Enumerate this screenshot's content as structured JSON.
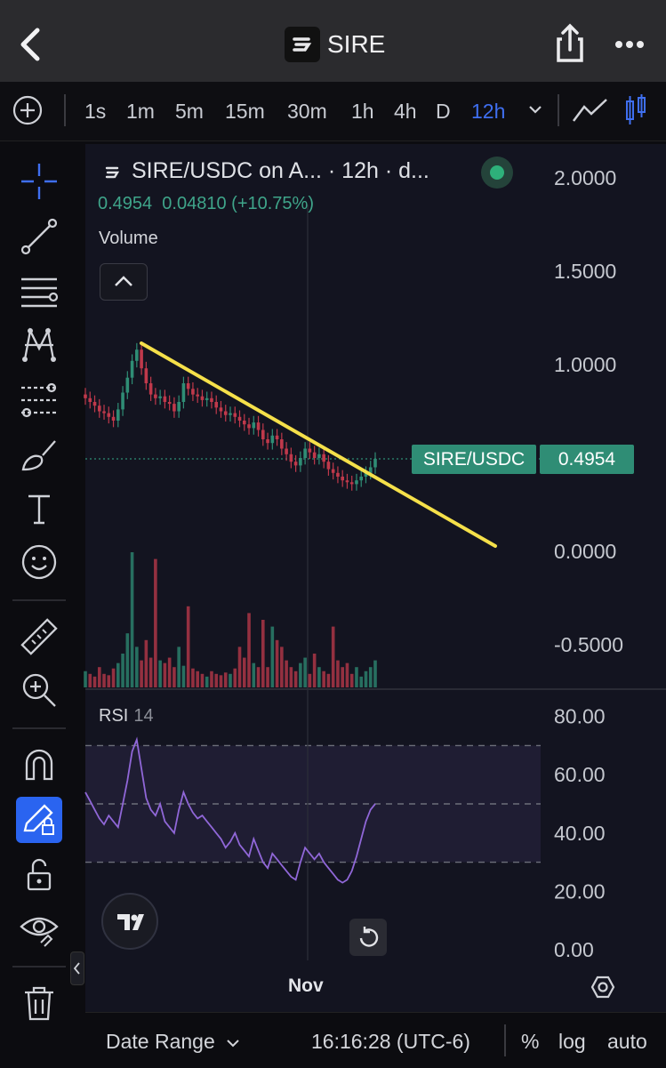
{
  "header": {
    "title": "SIRE"
  },
  "intervals": [
    {
      "label": "1s",
      "active": false
    },
    {
      "label": "1m",
      "active": false
    },
    {
      "label": "5m",
      "active": false
    },
    {
      "label": "15m",
      "active": false
    },
    {
      "label": "30m",
      "active": false
    },
    {
      "label": "1h",
      "active": false
    },
    {
      "label": "4h",
      "active": false
    },
    {
      "label": "D",
      "active": false
    },
    {
      "label": "12h",
      "active": true
    }
  ],
  "toolbar": {
    "icons": [
      "crosshair-icon",
      "trend-line-icon",
      "fib-levels-icon",
      "pattern-icon",
      "prediction-icon",
      "brush-icon",
      "text-icon",
      "emoji-icon",
      "ruler-icon",
      "zoom-in-icon",
      "magnet-icon",
      "lock-drawing-icon",
      "unlock-icon",
      "eye-icon",
      "trash-icon"
    ]
  },
  "chart": {
    "symbol_title": "SIRE/USDC on A... · 12h · d...",
    "ohlc": {
      "last": "0.4954",
      "change": "0.04810",
      "change_pct": "(+10.75%)"
    },
    "volume_label": "Volume",
    "price_tag": {
      "name": "SIRE/USDC",
      "value": "0.4954"
    },
    "rsi_label": "RSI",
    "rsi_length": "14",
    "x_axis_label": "Nov",
    "colors": {
      "up": "#2f8d75",
      "down": "#c0394b",
      "trendline": "#f5e04a",
      "rsi": "#9067d8",
      "accent": "#3f6ff0"
    }
  },
  "chart_data": {
    "type": "candlestick",
    "price_axis": {
      "ticks": [
        "2.0000",
        "1.5000",
        "1.0000",
        "0.0000",
        "-0.5000"
      ],
      "ylim": [
        -0.75,
        2.2
      ]
    },
    "rsi_axis": {
      "ticks": [
        "80.00",
        "60.00",
        "40.00",
        "20.00",
        "0.00"
      ],
      "levels": [
        70,
        50,
        30
      ]
    },
    "closes": [
      0.82,
      0.8,
      0.78,
      0.75,
      0.74,
      0.72,
      0.7,
      0.76,
      0.85,
      0.93,
      1.02,
      1.08,
      0.98,
      0.9,
      0.84,
      0.82,
      0.83,
      0.8,
      0.79,
      0.75,
      0.8,
      0.9,
      0.87,
      0.84,
      0.83,
      0.81,
      0.82,
      0.8,
      0.77,
      0.75,
      0.73,
      0.74,
      0.72,
      0.7,
      0.68,
      0.66,
      0.69,
      0.65,
      0.6,
      0.58,
      0.62,
      0.6,
      0.55,
      0.52,
      0.48,
      0.46,
      0.5,
      0.55,
      0.53,
      0.5,
      0.52,
      0.48,
      0.44,
      0.42,
      0.4,
      0.38,
      0.37,
      0.36,
      0.38,
      0.4,
      0.42,
      0.45,
      0.4954
    ],
    "volumes": [
      0.12,
      0.1,
      0.08,
      0.15,
      0.1,
      0.09,
      0.14,
      0.18,
      0.25,
      0.4,
      1.0,
      0.3,
      0.2,
      0.35,
      0.22,
      0.95,
      0.2,
      0.18,
      0.22,
      0.15,
      0.3,
      0.16,
      0.6,
      0.14,
      0.12,
      0.1,
      0.08,
      0.12,
      0.1,
      0.09,
      0.11,
      0.1,
      0.14,
      0.3,
      0.22,
      0.55,
      0.18,
      0.15,
      0.5,
      0.15,
      0.45,
      0.35,
      0.3,
      0.2,
      0.15,
      0.12,
      0.18,
      0.22,
      0.1,
      0.25,
      0.15,
      0.12,
      0.1,
      0.45,
      0.2,
      0.15,
      0.18,
      0.1,
      0.15,
      0.08,
      0.12,
      0.15,
      0.2
    ],
    "rsi": [
      54,
      51,
      48,
      45,
      43,
      46,
      44,
      42,
      50,
      58,
      68,
      72,
      62,
      52,
      48,
      46,
      50,
      44,
      42,
      40,
      48,
      54,
      50,
      47,
      45,
      46,
      44,
      42,
      40,
      38,
      35,
      37,
      40,
      36,
      34,
      32,
      38,
      34,
      30,
      28,
      33,
      31,
      29,
      27,
      25,
      24,
      30,
      35,
      33,
      31,
      33,
      30,
      28,
      26,
      24,
      23,
      24,
      27,
      32,
      38,
      44,
      48,
      50
    ],
    "trendline": {
      "from": [
        0,
        1.1
      ],
      "to": [
        1,
        0.05
      ]
    }
  },
  "bottom": {
    "date_range": "Date Range",
    "clock": "16:16:28 (UTC-6)",
    "percent": "%",
    "log": "log",
    "auto": "auto"
  }
}
